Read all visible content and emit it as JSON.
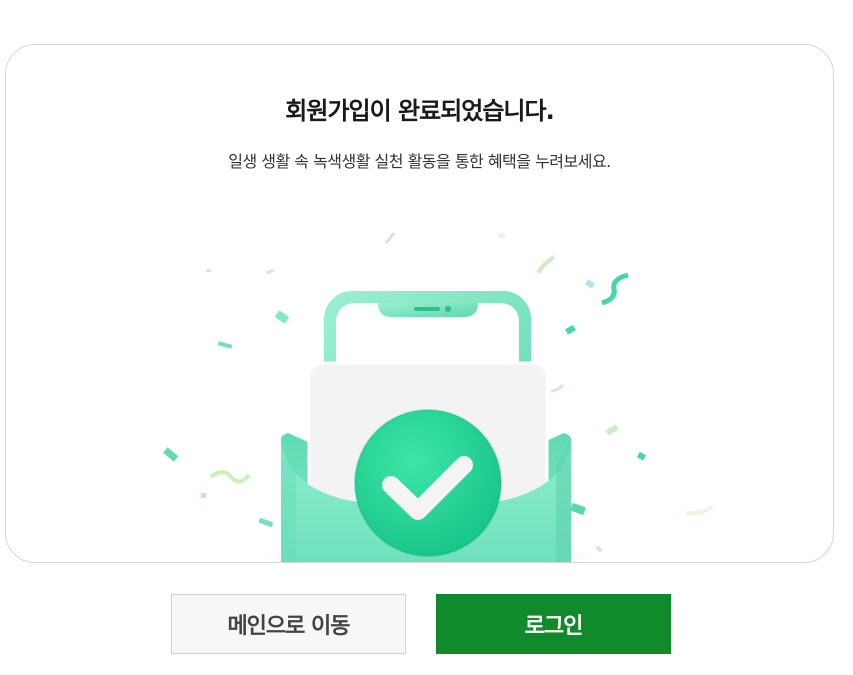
{
  "card": {
    "title": "회원가입이 완료되었습니다.",
    "subtitle": "일생 생활 속 녹색생활 실천 활동을 통한 혜택을 누려보세요."
  },
  "illustration": {
    "icon_name": "envelope-phone-checkmark",
    "accent_color": "#2fd3a0",
    "envelope_color": "#7ee6c4",
    "check_color": "#1fc98c"
  },
  "buttons": {
    "main_label": "메인으로 이동",
    "login_label": "로그인",
    "login_color": "#118a2b"
  }
}
